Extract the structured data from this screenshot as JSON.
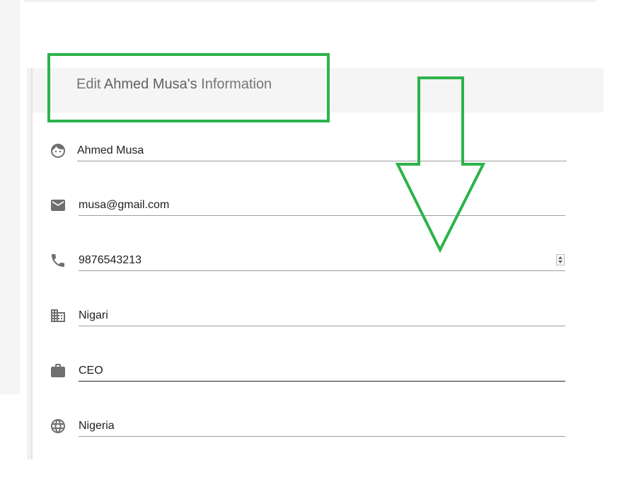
{
  "header": {
    "prefix": "Edit ",
    "name": "Ahmed Musa's",
    "suffix": " Information"
  },
  "fields": {
    "name": {
      "value": "Ahmed Musa",
      "icon": "face-icon"
    },
    "email": {
      "value": "musa@gmail.com",
      "icon": "mail-icon"
    },
    "phone": {
      "value": "9876543213",
      "icon": "phone-icon"
    },
    "company": {
      "value": "Nigari",
      "icon": "business-icon"
    },
    "job": {
      "value": "CEO",
      "icon": "work-icon"
    },
    "country": {
      "value": "Nigeria",
      "icon": "globe-icon"
    }
  },
  "colors": {
    "annotation": "#2db34a",
    "icon": "#6f6f6f"
  }
}
